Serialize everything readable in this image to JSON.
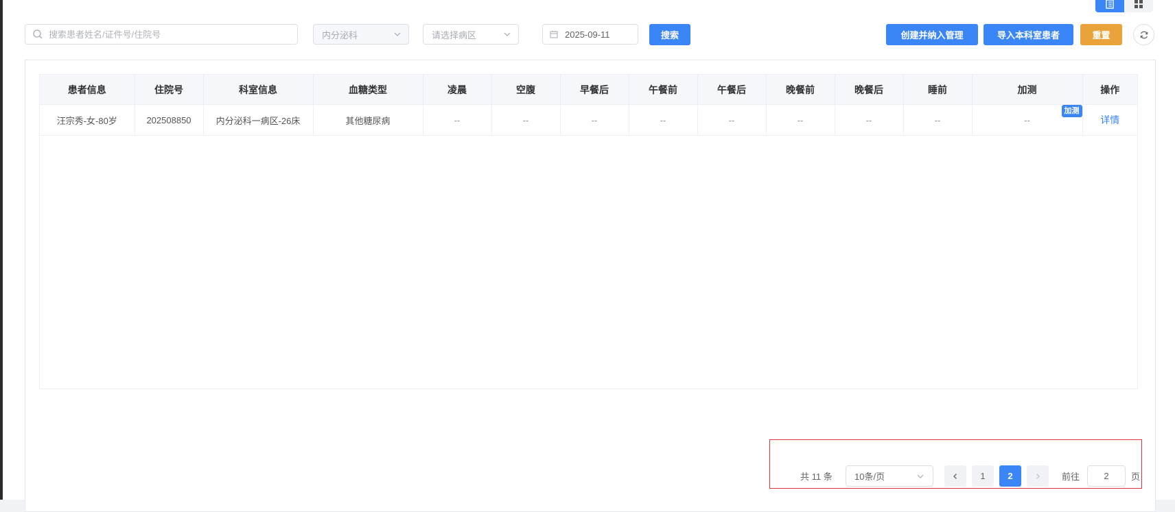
{
  "toolbar": {
    "search_placeholder": "搜索患者姓名/证件号/住院号",
    "department_value": "内分泌科",
    "ward_placeholder": "请选择病区",
    "date_value": "2025-09-11",
    "search_button": "搜索",
    "create_button": "创建并纳入管理",
    "import_button": "导入本科室患者",
    "reset_button": "重置"
  },
  "colors": {
    "primary": "#3b86f7",
    "warning": "#eaa33a",
    "highlight_border": "#e0323a"
  },
  "table": {
    "headers": [
      "患者信息",
      "住院号",
      "科室信息",
      "血糖类型",
      "凌晨",
      "空腹",
      "早餐后",
      "午餐前",
      "午餐后",
      "晚餐前",
      "晚餐后",
      "睡前",
      "加测",
      "操作"
    ],
    "rows": [
      {
        "patient": "汪宗秀-女-80岁",
        "admission_no": "202508850",
        "department": "内分泌科一病区-26床",
        "glucose_type": "其他糖尿病",
        "dawn": "--",
        "fasting": "--",
        "after_breakfast": "--",
        "before_lunch": "--",
        "after_lunch": "--",
        "before_dinner": "--",
        "after_dinner": "--",
        "bedtime": "--",
        "extra": "--",
        "extra_tag": "加测",
        "action": "详情"
      }
    ]
  },
  "pagination": {
    "total": "共 11 条",
    "page_size": "10条/页",
    "pages": [
      "1",
      "2"
    ],
    "current_page": "2",
    "goto_label": "前往",
    "goto_value": "2",
    "page_suffix": "页"
  },
  "icons": {
    "search": "search-icon",
    "chevron": "chevron-down-icon",
    "calendar": "calendar-icon",
    "refresh": "refresh-icon",
    "list_view": "list-view-icon",
    "grid_view": "grid-view-icon",
    "prev": "chevron-left-icon",
    "next": "chevron-right-icon"
  }
}
